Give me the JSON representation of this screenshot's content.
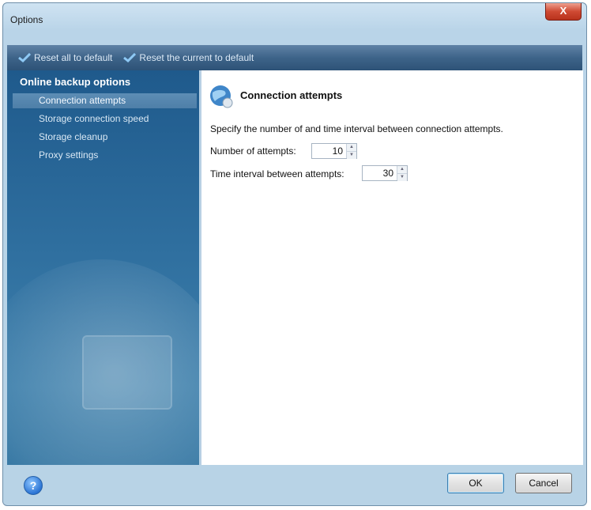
{
  "window": {
    "title": "Options",
    "close_label": "X"
  },
  "toolbar": {
    "reset_all_label": "Reset all to default",
    "reset_current_label": "Reset the current to default"
  },
  "sidebar": {
    "group_title": "Online backup options",
    "items": [
      {
        "label": "Connection attempts",
        "selected": true
      },
      {
        "label": "Storage connection speed",
        "selected": false
      },
      {
        "label": "Storage cleanup",
        "selected": false
      },
      {
        "label": "Proxy settings",
        "selected": false
      }
    ]
  },
  "content": {
    "title": "Connection attempts",
    "description": "Specify the number of and time interval between connection attempts.",
    "attempts": {
      "label": "Number of attempts:",
      "value": "10"
    },
    "interval": {
      "label": "Time interval between attempts:",
      "value": "30"
    }
  },
  "footer": {
    "help_label": "?",
    "ok_label": "OK",
    "cancel_label": "Cancel"
  }
}
